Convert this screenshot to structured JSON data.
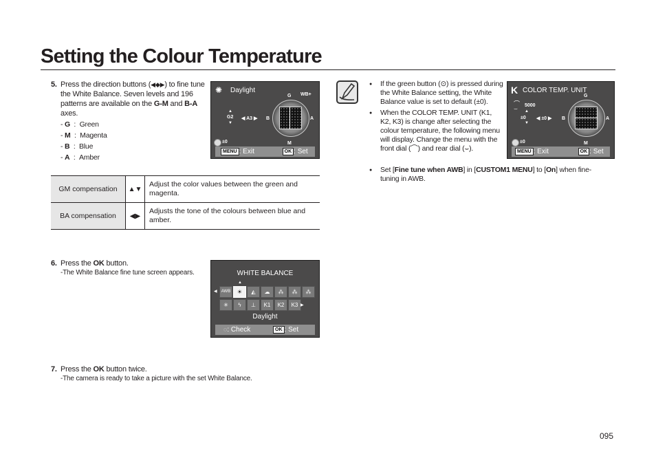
{
  "page": {
    "title": "Setting the Colour Temperature",
    "page_number": "095"
  },
  "step5": {
    "number": "5.",
    "text_a": "Press the direction buttons (",
    "dpad_icon": "direction-pad-icon",
    "text_b": ") to fine tune the White Balance. Seven levels and 196 patterns are available on the ",
    "axis1": "G-M",
    "text_c": " and ",
    "axis2": "B-A",
    "text_d": " axes.",
    "legend": [
      {
        "key": "G",
        "value": "Green"
      },
      {
        "key": "M",
        "value": "Magenta"
      },
      {
        "key": "B",
        "value": "Blue"
      },
      {
        "key": "A",
        "value": "Amber"
      }
    ]
  },
  "screen1": {
    "mode_icon": "daylight-icon",
    "mode_label": "Daylight",
    "wb_badge": "WB+",
    "g_label": "G",
    "m_label": "M",
    "b_label": "B",
    "a_label": "A",
    "gm_value": "G2",
    "ba_value": "◀ A3 ▶",
    "green_btn_value": "±0",
    "menu_chip": "MENU",
    "exit_label": ": Exit",
    "ok_chip": "OK",
    "set_label": ": Set"
  },
  "table": {
    "rows": [
      {
        "label": "GM compensation",
        "symbol": "▲▼",
        "description": "Adjust the color values between the green and magenta."
      },
      {
        "label": "BA compensation",
        "symbol": "◀▶",
        "description": "Adjusts the tone of the colours between blue and amber."
      }
    ]
  },
  "step6": {
    "number": "6.",
    "text_a": "Press the ",
    "bold": "OK",
    "text_b": " button.",
    "sub": "-The White Balance fine tune screen appears."
  },
  "screen2": {
    "title": "WHITE BALANCE",
    "row1": [
      "AWB",
      "☀",
      "◭",
      "☁",
      "⁂",
      "⁂",
      "⁂"
    ],
    "row2": [
      "✳",
      "ϟ",
      "⊥",
      "K1",
      "K2",
      "K3"
    ],
    "selected_index": 1,
    "selected_label": "Daylight",
    "check_label": ": Check",
    "ok_chip": "OK",
    "set_label": ": Set"
  },
  "step7": {
    "number": "7.",
    "text_a": "Press the ",
    "bold": "OK",
    "text_b": " button twice.",
    "sub": "-The camera is ready to take a picture with the set White Balance."
  },
  "notes": {
    "icon": "note-pencil-icon",
    "bullets": [
      {
        "text": "If the green button (⊙) is pressed during the White Balance setting, the White Balance value is set to default (±0)."
      },
      {
        "text": "When the COLOR TEMP. UNIT (K1, K2, K3) is change after selecting the colour temperature, the following menu will display. Change the menu with the front dial (⌒) and rear dial (⌣)."
      }
    ],
    "bullet3": {
      "a": "Set [",
      "b1": "Fine tune when AWB",
      "c": "] in [",
      "b2": "CUSTOM1 MENU",
      "d": "] to [",
      "b3": "On",
      "e": "] when fine-tuning in AWB."
    }
  },
  "screen3": {
    "mode_icon": "K",
    "title": "COLOR TEMP. UNIT",
    "temp_value": "5000",
    "gm_value": "±0",
    "ba_value": "◀ ±0 ▶",
    "g_label": "G",
    "m_label": "M",
    "b_label": "B",
    "a_label": "A",
    "green_btn_value": "±0",
    "menu_chip": "MENU",
    "exit_label": ": Exit",
    "ok_chip": "OK",
    "set_label": ": Set"
  }
}
